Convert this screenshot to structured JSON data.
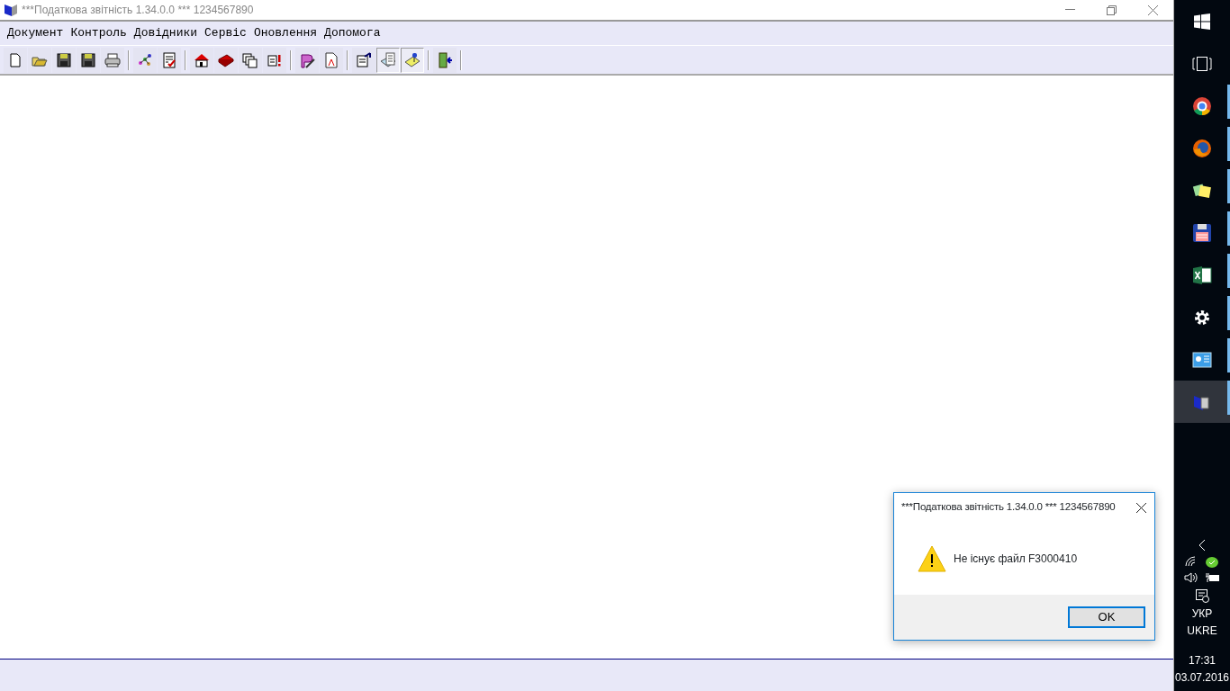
{
  "window": {
    "title": "***Податкова звітність 1.34.0.0 *** 1234567890"
  },
  "menu": [
    "Документ",
    "Контроль",
    "Довідники",
    "Сервіс",
    "Оновлення",
    "Допомога"
  ],
  "toolbar": [
    {
      "buttons": [
        {
          "pressed": false
        },
        {
          "pressed": false
        },
        {
          "pressed": false
        },
        {
          "pressed": false
        },
        {
          "pressed": false
        }
      ]
    },
    {
      "buttons": [
        {
          "pressed": false
        },
        {
          "pressed": false
        }
      ]
    },
    {
      "buttons": [
        {
          "pressed": false
        },
        {
          "pressed": false
        },
        {
          "pressed": false
        },
        {
          "pressed": false
        }
      ]
    },
    {
      "buttons": [
        {
          "pressed": false
        },
        {
          "pressed": false
        }
      ]
    },
    {
      "buttons": [
        {
          "pressed": false
        },
        {
          "pressed": true
        },
        {
          "pressed": true
        }
      ]
    },
    {
      "buttons": [
        {
          "pressed": false
        }
      ]
    }
  ],
  "dialog": {
    "title": "***Податкова звітність 1.34.0.0 *** 1234567890",
    "message": "Не існує файл F3000410",
    "buttons": [
      "OK"
    ]
  },
  "taskbar": {
    "apps": [
      {
        "selected": false
      },
      {
        "selected": false
      },
      {
        "selected": false
      },
      {
        "selected": false
      },
      {
        "selected": false
      },
      {
        "selected": false
      },
      {
        "selected": false
      },
      {
        "selected": true
      }
    ],
    "language": [
      "УКР",
      "UKRE"
    ],
    "time": "17:31",
    "date": "03.07.2016"
  }
}
